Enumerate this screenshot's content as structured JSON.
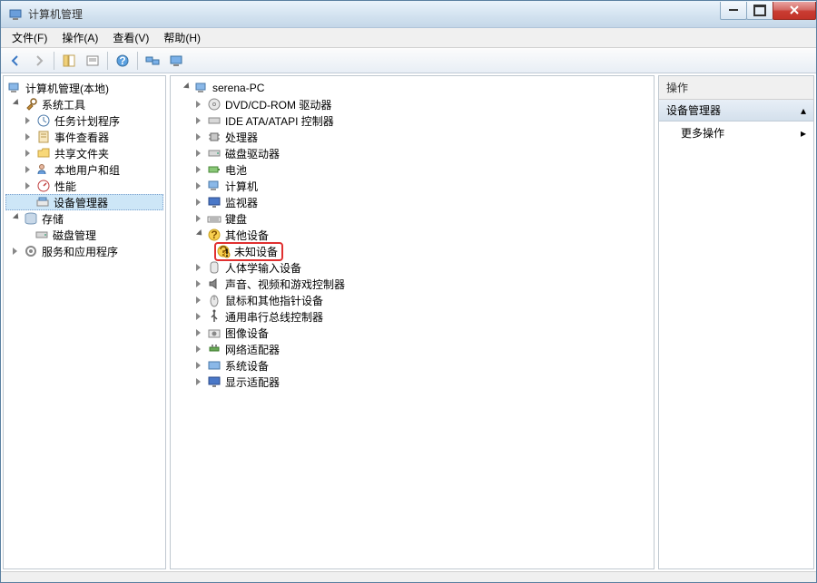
{
  "window": {
    "title": "计算机管理"
  },
  "menu": {
    "file": "文件(F)",
    "action": "操作(A)",
    "view": "查看(V)",
    "help": "帮助(H)"
  },
  "left_tree": {
    "root": "计算机管理(本地)",
    "sys_tools": "系统工具",
    "task_scheduler": "任务计划程序",
    "event_viewer": "事件查看器",
    "shared_folders": "共享文件夹",
    "local_users": "本地用户和组",
    "performance": "性能",
    "device_manager": "设备管理器",
    "storage": "存储",
    "disk_mgmt": "磁盘管理",
    "services_apps": "服务和应用程序"
  },
  "devices": {
    "root": "serena-PC",
    "dvd": "DVD/CD-ROM 驱动器",
    "ide": "IDE ATA/ATAPI 控制器",
    "cpu": "处理器",
    "disk": "磁盘驱动器",
    "battery": "电池",
    "computer": "计算机",
    "monitor": "监视器",
    "keyboard": "键盘",
    "other": "其他设备",
    "unknown": "未知设备",
    "hid": "人体学输入设备",
    "sound": "声音、视频和游戏控制器",
    "mouse": "鼠标和其他指针设备",
    "usb": "通用串行总线控制器",
    "imaging": "图像设备",
    "network": "网络适配器",
    "system": "系统设备",
    "display": "显示适配器"
  },
  "actions": {
    "header": "操作",
    "sub": "设备管理器",
    "more": "更多操作"
  }
}
